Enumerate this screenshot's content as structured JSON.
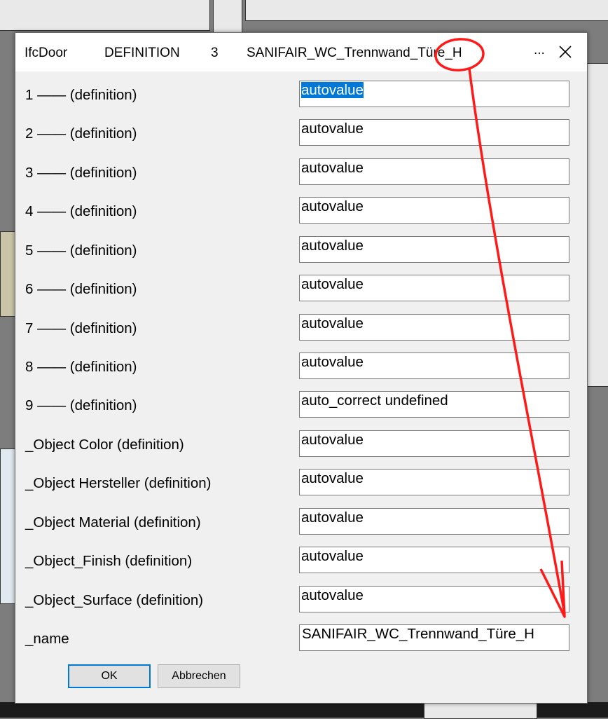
{
  "dialog": {
    "title": {
      "entity": "IfcDoor",
      "category": "DEFINITION",
      "number": "3",
      "name": "SANIFAIR_WC_Trennwand_Türe_H",
      "more": "..."
    },
    "fields": [
      {
        "label": "1 —— (definition)",
        "value": "autovalue",
        "selected": true
      },
      {
        "label": "2 —— (definition)",
        "value": "autovalue"
      },
      {
        "label": "3 —— (definition)",
        "value": "autovalue"
      },
      {
        "label": "4 —— (definition)",
        "value": "autovalue"
      },
      {
        "label": "5 —— (definition)",
        "value": "autovalue"
      },
      {
        "label": "6 —— (definition)",
        "value": "autovalue"
      },
      {
        "label": "7 —— (definition)",
        "value": "autovalue"
      },
      {
        "label": "8 —— (definition)",
        "value": "autovalue"
      },
      {
        "label": "9 —— (definition)",
        "value": "auto_correct undefined"
      },
      {
        "label": "_Object Color (definition)",
        "value": "autovalue"
      },
      {
        "label": "_Object Hersteller (definition)",
        "value": "autovalue"
      },
      {
        "label": "_Object Material (definition)",
        "value": "autovalue"
      },
      {
        "label": "_Object_Finish (definition)",
        "value": "autovalue"
      },
      {
        "label": "_Object_Surface (definition)",
        "value": "autovalue"
      },
      {
        "label": "_name",
        "value": "SANIFAIR_WC_Trennwand_Türe_H"
      }
    ],
    "buttons": {
      "ok": "OK",
      "cancel": "Abbrechen"
    }
  },
  "colors": {
    "annotation": "#ff1a1a",
    "selection": "#0078d7"
  },
  "icons": {
    "close": "close-icon"
  }
}
